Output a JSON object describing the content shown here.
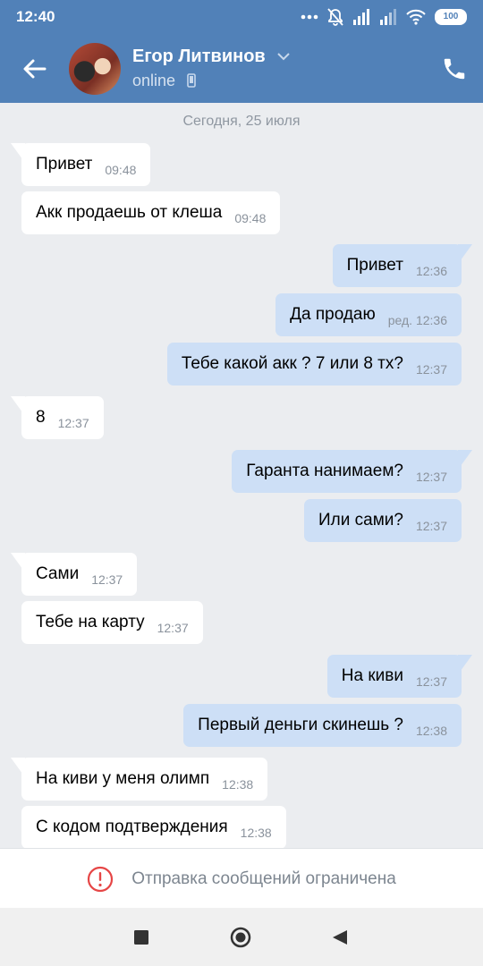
{
  "status_bar": {
    "time": "12:40",
    "battery": "100"
  },
  "contact": {
    "name": "Егор Литвинов",
    "status": "online"
  },
  "chat": {
    "date": "Сегодня, 25 июля",
    "messages": [
      {
        "dir": "in",
        "text": "Привет",
        "time": "09:48"
      },
      {
        "dir": "in",
        "text": "Акк продаешь от клеша",
        "time": "09:48"
      },
      {
        "dir": "out",
        "text": "Привет",
        "time": "12:36"
      },
      {
        "dir": "out",
        "text": "Да продаю",
        "time": "ред. 12:36"
      },
      {
        "dir": "out",
        "text": "Тебе какой акк ? 7 или 8 тх?",
        "time": "12:37"
      },
      {
        "dir": "in",
        "text": "8",
        "time": "12:37"
      },
      {
        "dir": "out",
        "text": "Гаранта нанимаем?",
        "time": "12:37"
      },
      {
        "dir": "out",
        "text": "Или сами?",
        "time": "12:37"
      },
      {
        "dir": "in",
        "text": "Сами",
        "time": "12:37"
      },
      {
        "dir": "in",
        "text": "Тебе на карту",
        "time": "12:37"
      },
      {
        "dir": "out",
        "text": "На киви",
        "time": "12:37"
      },
      {
        "dir": "out",
        "text": "Первый деньги скинешь ?",
        "time": "12:38"
      },
      {
        "dir": "in",
        "text": "На киви у меня олимп",
        "time": "12:38"
      },
      {
        "dir": "in",
        "text": "С кодом подтверждения",
        "time": "12:38"
      }
    ]
  },
  "restriction": {
    "text": "Отправка сообщений ограничена"
  },
  "colors": {
    "header": "#5181b8",
    "incoming": "#ffffff",
    "outgoing": "#cddff6",
    "alert": "#e64646"
  }
}
